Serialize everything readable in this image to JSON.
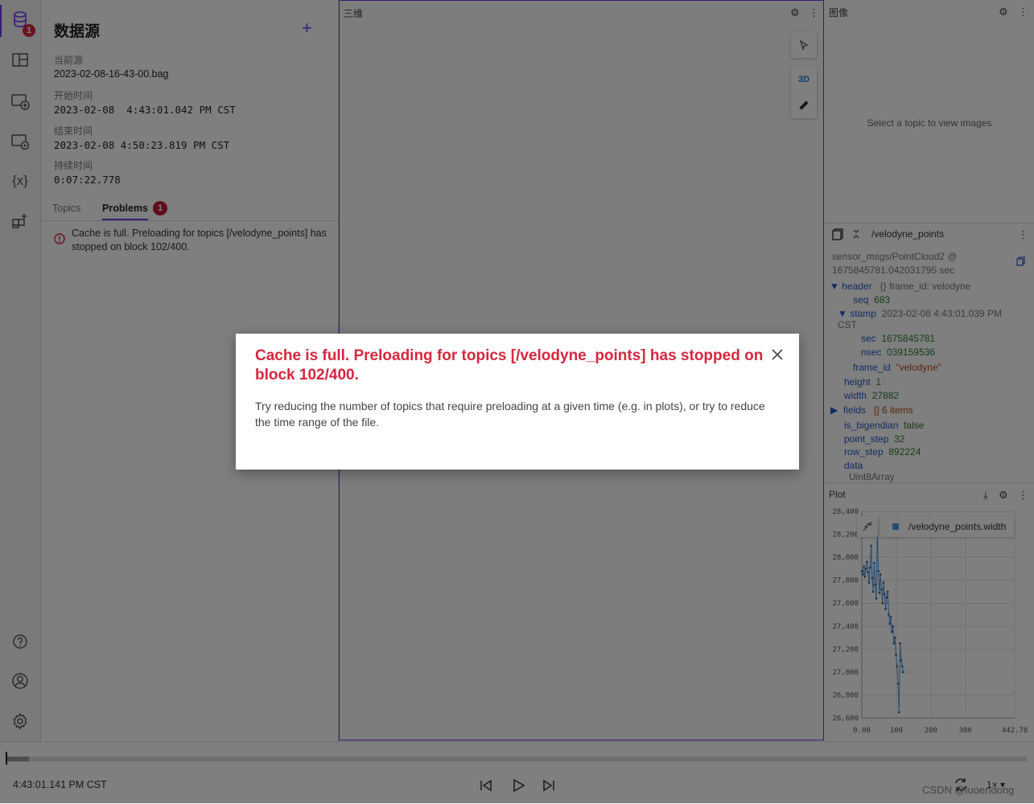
{
  "rail": {
    "badge": "1",
    "icons": [
      "database-icon",
      "layout-icon",
      "add-panel-icon",
      "panel-settings-icon",
      "variables-icon",
      "extensions-icon",
      "help-icon",
      "account-icon",
      "gear-icon"
    ],
    "variables_glyph": "{x}"
  },
  "sidebar": {
    "title": "数据源",
    "add_glyph": "+",
    "current_source_label": "当前源",
    "current_source": "2023-02-08-16-43-00.bag",
    "start_label": "开始时间",
    "start_value": "2023-02-08  4:43:01.042 PM CST",
    "end_label": "结束时间",
    "end_value": "2023-02-08 4:50:23.819 PM CST",
    "duration_label": "持续时间",
    "duration_value": "0:07:22.778",
    "tabs": [
      {
        "label": "Topics"
      },
      {
        "label": "Problems",
        "badge": "1"
      }
    ],
    "problem_text": "Cache is full. Preloading for topics [/velodyne_points] has stopped on block 102/400."
  },
  "panel3d": {
    "title": "三维",
    "mode_label": "3D"
  },
  "panel_image": {
    "title": "图像",
    "empty_message": "Select a topic to view images"
  },
  "panel_message": {
    "topic": "/velodyne_points",
    "type_line": "sensor_msgs/PointCloud2 @",
    "time_line": "1675845781.042031795 sec",
    "rows": {
      "header_key": "header",
      "header_summary": "{} frame_id: velodyne",
      "seq_key": "seq",
      "seq_val": "683",
      "stamp_key": "stamp",
      "stamp_val": "2023-02-08 4:43:01.039 PM",
      "stamp_tz": "CST",
      "sec_key": "sec",
      "sec_val": "1675845781",
      "nsec_key": "nsec",
      "nsec_val": "039159536",
      "frame_key": "frame_id",
      "frame_val": "\"velodyne\"",
      "height_key": "height",
      "height_val": "1",
      "width_key": "width",
      "width_val": "27882",
      "fields_key": "fields",
      "fields_val": "[] 6 items",
      "bigendian_key": "is_bigendian",
      "bigendian_val": "false",
      "point_step_key": "point_step",
      "point_step_val": "32",
      "row_step_key": "row_step",
      "row_step_val": "892224",
      "data_key": "data",
      "data_val": "Uint8Array"
    }
  },
  "panel_plot": {
    "title": "Plot",
    "legend": "/velodyne_points.width"
  },
  "chart_data": {
    "type": "line",
    "series": [
      {
        "name": "/velodyne_points.width"
      }
    ],
    "y_ticks": [
      "28,400",
      "28,200",
      "28,000",
      "27,800",
      "27,600",
      "27,400",
      "27,200",
      "27,000",
      "26,800",
      "26,600"
    ],
    "x_ticks": [
      "0.00",
      "100",
      "200",
      "300",
      "442.78"
    ],
    "ylim": [
      26600,
      28400
    ],
    "xlim": [
      0,
      442.78
    ],
    "x": [
      0,
      3,
      6,
      9,
      12,
      15,
      18,
      21,
      24,
      27,
      30,
      33,
      36,
      39,
      42,
      45,
      48,
      51,
      54,
      57,
      60,
      63,
      66,
      69,
      72,
      75,
      78,
      81,
      84,
      87,
      90,
      93,
      96,
      99,
      102,
      105,
      108,
      111,
      114,
      117,
      120
    ],
    "y": [
      27880,
      27850,
      27920,
      27830,
      27900,
      27960,
      27870,
      27780,
      27910,
      28100,
      27820,
      27700,
      27950,
      27760,
      27640,
      28250,
      27880,
      27690,
      27850,
      27720,
      27600,
      27780,
      27680,
      27550,
      27650,
      27700,
      27500,
      27420,
      27480,
      27350,
      27400,
      27250,
      27300,
      27150,
      27050,
      26900,
      26650,
      27250,
      27100,
      27050,
      27000
    ],
    "grid": true
  },
  "playback": {
    "time": "4:43:01.141 PM CST",
    "progress": 0.022,
    "speed": "1×",
    "watermark": "CSDN @luoendong"
  },
  "dialog": {
    "title": "Cache is full. Preloading for topics [/velodyne_points] has stopped on block 102/400.",
    "body": "Try reducing the number of topics that require preloading at a given time (e.g. in plots), or try to reduce the time range of the file."
  }
}
